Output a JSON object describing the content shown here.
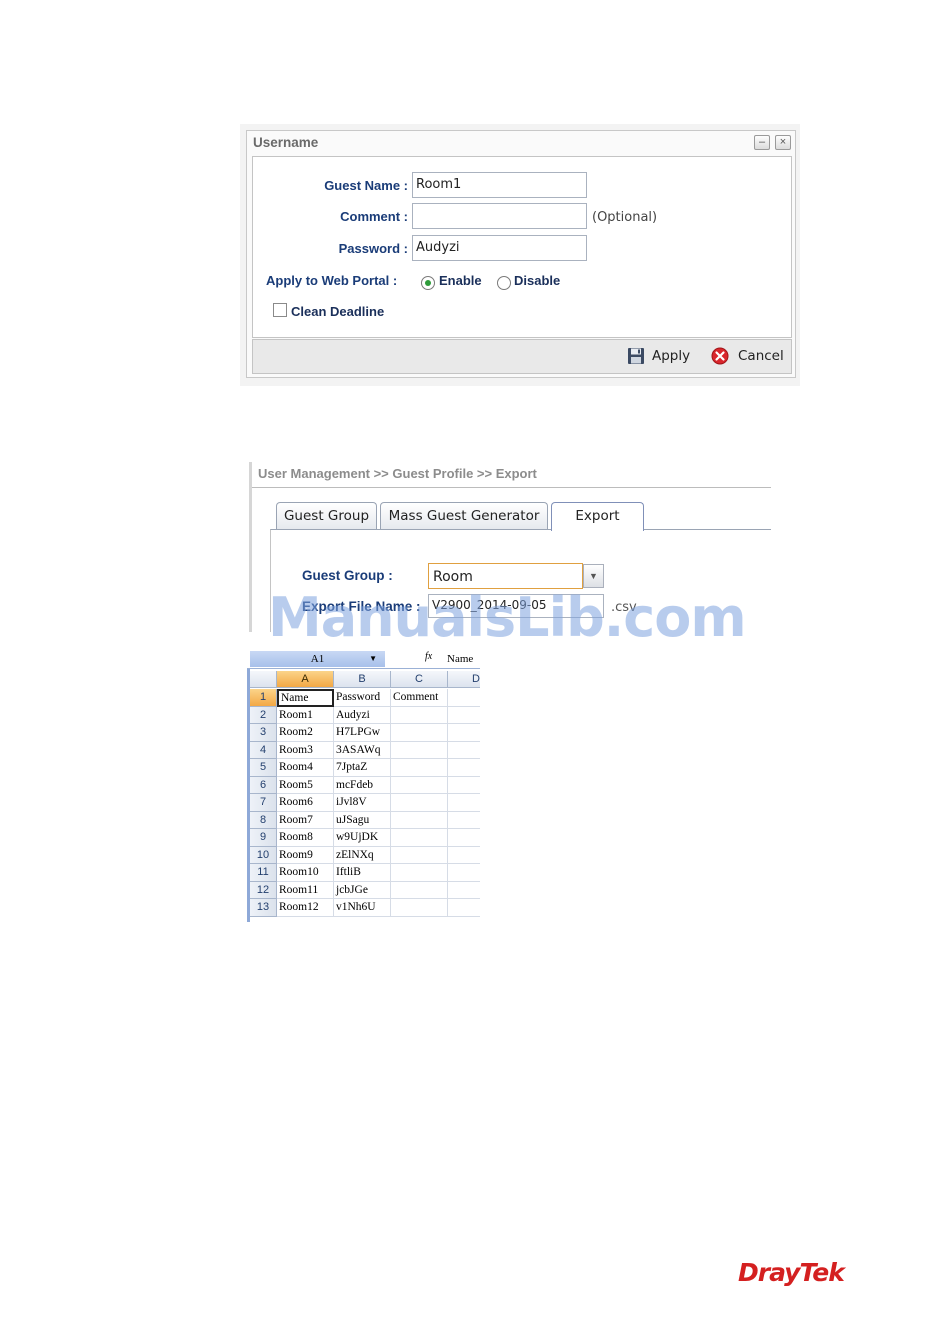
{
  "dialog": {
    "title": "Username",
    "minimize_glyph": "–",
    "close_glyph": "×",
    "guest_name_label": "Guest Name :",
    "guest_name_value": "Room1",
    "comment_label": "Comment :",
    "comment_value": "",
    "optional_text": "(Optional)",
    "password_label": "Password :",
    "password_value": "Audyzi",
    "web_portal_label": "Apply to Web Portal :",
    "enable_label": "Enable",
    "disable_label": "Disable",
    "web_portal_selected": "Enable",
    "clean_deadline_label": "Clean Deadline",
    "apply_label": "Apply",
    "cancel_label": "Cancel"
  },
  "export_panel": {
    "breadcrumb": "User Management >> Guest Profile >> Export",
    "tabs": [
      {
        "label": "Guest Group"
      },
      {
        "label": "Mass Guest Generator"
      },
      {
        "label": "Export"
      }
    ],
    "active_tab": "Export",
    "guest_group_label": "Guest Group :",
    "guest_group_value": "Room",
    "export_file_label": "Export File Name :",
    "export_file_value": "V2900_2014-09-05",
    "export_file_ext": ".csv"
  },
  "watermark": "ManualsLib.com",
  "spreadsheet": {
    "name_box": "A1",
    "fx_symbol": "fx",
    "formula_value": "Name",
    "columns": [
      "A",
      "B",
      "C",
      "D"
    ],
    "rows": [
      {
        "num": "1",
        "a": "Name",
        "b": "Password",
        "c": "Comment"
      },
      {
        "num": "2",
        "a": "Room1",
        "b": "Audyzi",
        "c": ""
      },
      {
        "num": "3",
        "a": "Room2",
        "b": "H7LPGw",
        "c": ""
      },
      {
        "num": "4",
        "a": "Room3",
        "b": "3ASAWq",
        "c": ""
      },
      {
        "num": "5",
        "a": "Room4",
        "b": "7JptaZ",
        "c": ""
      },
      {
        "num": "6",
        "a": "Room5",
        "b": "mcFdeb",
        "c": ""
      },
      {
        "num": "7",
        "a": "Room6",
        "b": "iJvl8V",
        "c": ""
      },
      {
        "num": "8",
        "a": "Room7",
        "b": "uJSagu",
        "c": ""
      },
      {
        "num": "9",
        "a": "Room8",
        "b": "w9UjDK",
        "c": ""
      },
      {
        "num": "10",
        "a": "Room9",
        "b": "zElNXq",
        "c": ""
      },
      {
        "num": "11",
        "a": "Room10",
        "b": "IftliB",
        "c": ""
      },
      {
        "num": "12",
        "a": "Room11",
        "b": "jcbJGe",
        "c": ""
      },
      {
        "num": "13",
        "a": "Room12",
        "b": "v1Nh6U",
        "c": ""
      }
    ]
  },
  "logo": "DrayTek",
  "colors": {
    "label_blue": "#1a3c78",
    "radio_green": "#2e9b3a",
    "logo_red": "#d42020",
    "select_highlight": "#f3a845"
  }
}
